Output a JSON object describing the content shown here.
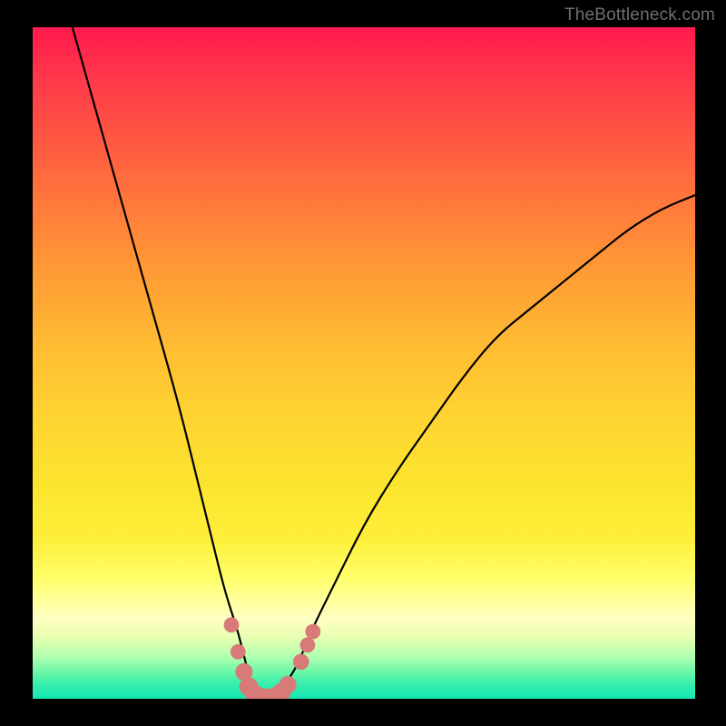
{
  "watermark": {
    "text": "TheBottleneck.com"
  },
  "chart_data": {
    "type": "line",
    "title": "",
    "xlabel": "",
    "ylabel": "",
    "ylim": [
      0,
      100
    ],
    "xlim": [
      0,
      100
    ],
    "series": [
      {
        "name": "bottleneck-curve",
        "x": [
          6,
          10,
          14,
          18,
          22,
          25,
          27,
          29,
          31,
          32,
          33,
          34,
          35,
          36,
          38,
          40,
          42,
          45,
          50,
          55,
          60,
          65,
          70,
          75,
          80,
          85,
          90,
          95,
          100
        ],
        "values": [
          100,
          86,
          72,
          58,
          44,
          32,
          24,
          16,
          10,
          6,
          2,
          0,
          0,
          0,
          2,
          5,
          10,
          16,
          26,
          34,
          41,
          48,
          54,
          58,
          62,
          66,
          70,
          73,
          75
        ]
      }
    ],
    "markers": {
      "name": "highlighted-points",
      "color": "#d87a78",
      "points": [
        {
          "x": 30.0,
          "y": 11.0,
          "r": 1.1
        },
        {
          "x": 31.0,
          "y": 7.0,
          "r": 1.1
        },
        {
          "x": 31.9,
          "y": 4.0,
          "r": 1.4
        },
        {
          "x": 32.6,
          "y": 1.8,
          "r": 1.6
        },
        {
          "x": 33.5,
          "y": 0.7,
          "r": 1.6
        },
        {
          "x": 34.5,
          "y": 0.2,
          "r": 1.6
        },
        {
          "x": 35.5,
          "y": 0.1,
          "r": 1.6
        },
        {
          "x": 36.5,
          "y": 0.3,
          "r": 1.6
        },
        {
          "x": 37.5,
          "y": 0.9,
          "r": 1.6
        },
        {
          "x": 38.5,
          "y": 2.1,
          "r": 1.4
        },
        {
          "x": 40.5,
          "y": 5.5,
          "r": 1.2
        },
        {
          "x": 41.5,
          "y": 8.0,
          "r": 1.1
        },
        {
          "x": 42.3,
          "y": 10.0,
          "r": 1.1
        }
      ]
    },
    "background_gradient": {
      "direction": "vertical",
      "stops": [
        {
          "pos": 0,
          "color": "#ff1a4d"
        },
        {
          "pos": 40,
          "color": "#ff9635"
        },
        {
          "pos": 70,
          "color": "#fbe42e"
        },
        {
          "pos": 88,
          "color": "#ffffc2"
        },
        {
          "pos": 100,
          "color": "#14e7b2"
        }
      ]
    }
  }
}
